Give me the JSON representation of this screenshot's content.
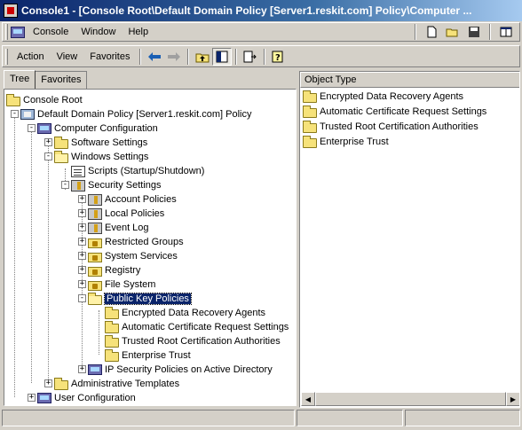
{
  "window": {
    "title": "Console1 - [Console Root\\Default Domain Policy [Server1.reskit.com] Policy\\Computer ..."
  },
  "menubar": {
    "items": [
      {
        "label": "Console"
      },
      {
        "label": "Window"
      },
      {
        "label": "Help"
      }
    ]
  },
  "toolbar": {
    "action_label": "Action",
    "view_label": "View",
    "favorites_label": "Favorites"
  },
  "tabs": [
    {
      "label": "Tree",
      "active": true
    },
    {
      "label": "Favorites",
      "active": false
    }
  ],
  "tree": {
    "nodes": [
      {
        "label": "Console Root",
        "icon": "folder-icon"
      },
      {
        "label": "Default Domain Policy [Server1.reskit.com] Policy",
        "icon": "policy-icon",
        "expander": "-"
      },
      {
        "label": "Computer Configuration",
        "icon": "computer-icon",
        "expander": "-"
      },
      {
        "label": "Software Settings",
        "icon": "folder-icon",
        "expander": "+"
      },
      {
        "label": "Windows Settings",
        "icon": "folder-icon",
        "expander": "-"
      },
      {
        "label": "Scripts (Startup/Shutdown)",
        "icon": "script-icon"
      },
      {
        "label": "Security Settings",
        "icon": "security-icon",
        "expander": "-"
      },
      {
        "label": "Account Policies",
        "icon": "security-icon",
        "expander": "+"
      },
      {
        "label": "Local Policies",
        "icon": "security-icon",
        "expander": "+"
      },
      {
        "label": "Event Log",
        "icon": "security-icon",
        "expander": "+"
      },
      {
        "label": "Restricted Groups",
        "icon": "lock-folder-icon",
        "expander": "+"
      },
      {
        "label": "System Services",
        "icon": "lock-folder-icon",
        "expander": "+"
      },
      {
        "label": "Registry",
        "icon": "lock-folder-icon",
        "expander": "+"
      },
      {
        "label": "File System",
        "icon": "lock-folder-icon",
        "expander": "+"
      },
      {
        "label": "Public Key Policies",
        "icon": "open-folder-icon",
        "expander": "-",
        "selected": true
      },
      {
        "label": "Encrypted Data Recovery Agents",
        "icon": "folder-icon"
      },
      {
        "label": "Automatic Certificate Request Settings",
        "icon": "folder-icon"
      },
      {
        "label": "Trusted Root Certification Authorities",
        "icon": "folder-icon"
      },
      {
        "label": "Enterprise Trust",
        "icon": "folder-icon"
      },
      {
        "label": "IP Security Policies on Active Directory",
        "icon": "ip-security-icon",
        "expander": "+"
      },
      {
        "label": "Administrative Templates",
        "icon": "folder-icon",
        "expander": "+"
      },
      {
        "label": "User Configuration",
        "icon": "user-config-icon",
        "expander": "+"
      }
    ]
  },
  "list": {
    "column_header": "Object Type",
    "items": [
      {
        "label": "Encrypted Data Recovery Agents"
      },
      {
        "label": "Automatic Certificate Request Settings"
      },
      {
        "label": "Trusted Root Certification Authorities"
      },
      {
        "label": "Enterprise Trust"
      }
    ]
  }
}
